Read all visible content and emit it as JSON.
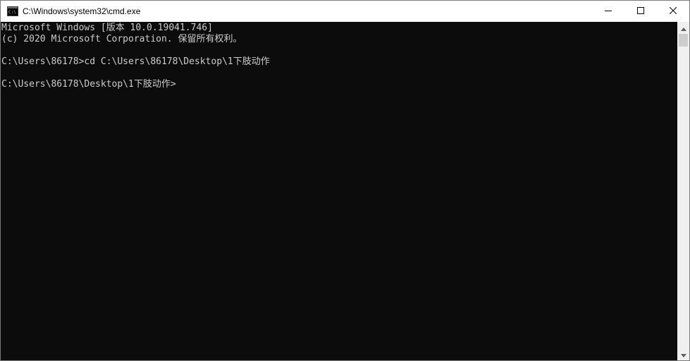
{
  "window": {
    "title": "C:\\Windows\\system32\\cmd.exe",
    "icon": "cmd-icon"
  },
  "controls": {
    "minimize_icon": "minimize-icon",
    "maximize_icon": "maximize-icon",
    "close_icon": "close-icon"
  },
  "console": {
    "lines": [
      "Microsoft Windows [版本 10.0.19041.746]",
      "(c) 2020 Microsoft Corporation. 保留所有权利。",
      "",
      "C:\\Users\\86178>cd C:\\Users\\86178\\Desktop\\1下肢动作",
      "",
      "C:\\Users\\86178\\Desktop\\1下肢动作>"
    ],
    "background": "#0c0c0c",
    "foreground": "#cccccc"
  },
  "scrollbar": {
    "up_icon": "scroll-up-arrow-icon",
    "down_icon": "scroll-down-arrow-icon"
  }
}
